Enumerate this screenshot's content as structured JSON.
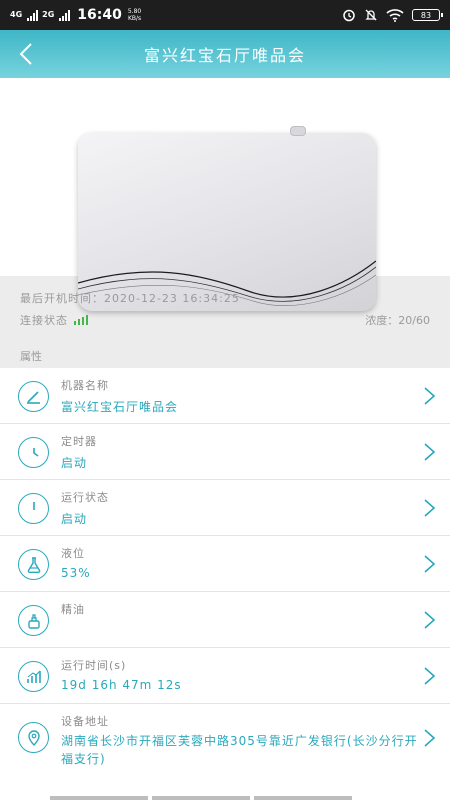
{
  "status_bar": {
    "network_4g": "4G",
    "network_2g": "2G",
    "time": "16:40",
    "speed_value": "5.80",
    "speed_unit": "KB/s",
    "battery": "83"
  },
  "header": {
    "title": "富兴红宝石厅唯品会"
  },
  "hero": {
    "last_boot": "最后开机时间：2020-12-23  16:34:25",
    "connection_label": "连接状态",
    "concentration": "浓度：20/60",
    "section_title": "属性"
  },
  "rows": [
    {
      "icon": "pencil-icon",
      "label": "机器名称",
      "value": "富兴红宝石厅唯品会"
    },
    {
      "icon": "clock-icon",
      "label": "定时器",
      "value": "启动"
    },
    {
      "icon": "power-icon",
      "label": "运行状态",
      "value": "启动"
    },
    {
      "icon": "flask-icon",
      "label": "液位",
      "value": "53%"
    },
    {
      "icon": "oil-icon",
      "label": "精油",
      "value": ""
    },
    {
      "icon": "chart-icon",
      "label": "运行时间(s)",
      "value": "19d  16h  47m  12s"
    },
    {
      "icon": "location-icon",
      "label": "设备地址",
      "value": "湖南省长沙市开福区芙蓉中路305号靠近广发银行(长沙分行开福支行)"
    }
  ],
  "colors": {
    "accent": "#2aa9bd",
    "header_top": "#3fb6c6",
    "header_bottom": "#77d3de",
    "signal_green": "#45b649"
  }
}
